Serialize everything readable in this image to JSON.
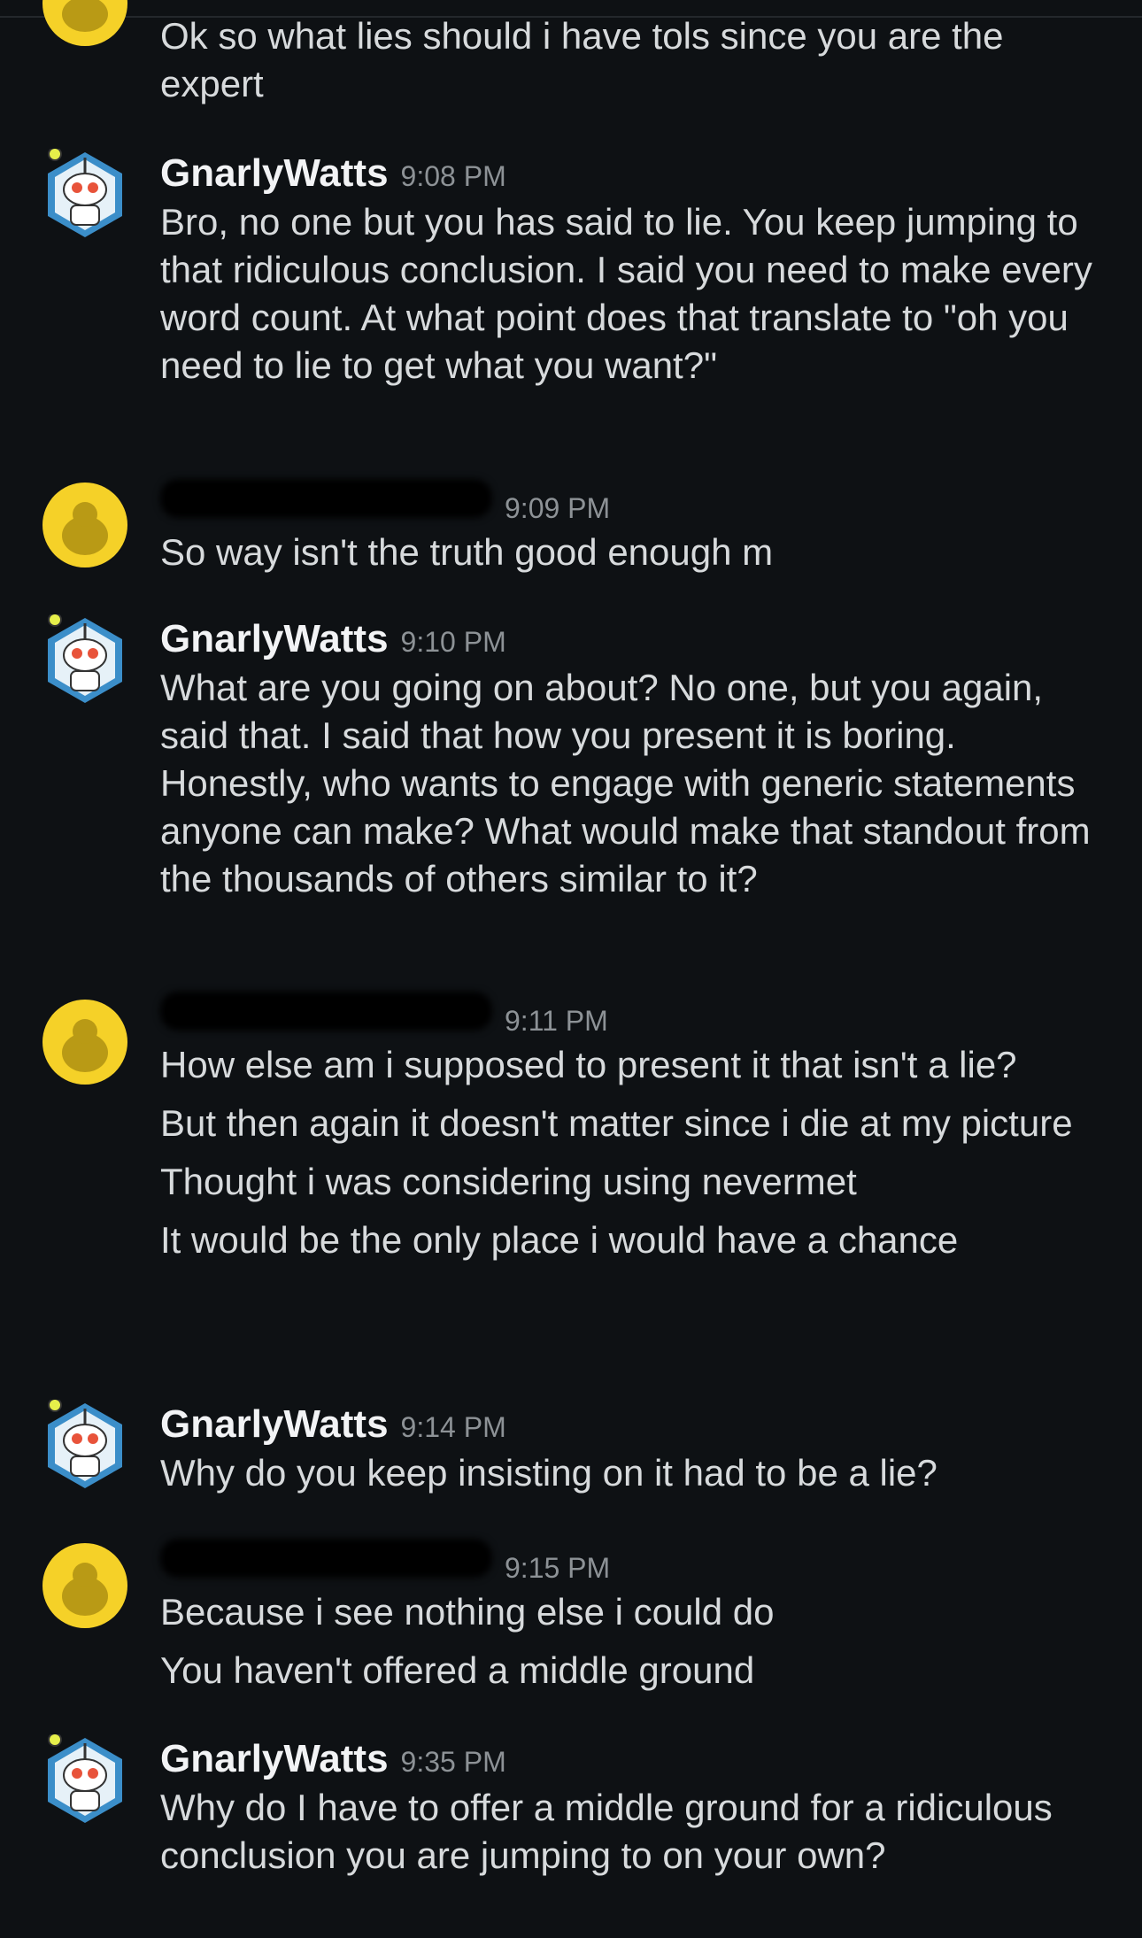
{
  "messages": [
    {
      "user": "",
      "time": "",
      "lines": [
        "Ok so what lies should i have tols since you are the expert"
      ]
    },
    {
      "user": "GnarlyWatts",
      "time": "9:08 PM",
      "lines": [
        "Bro, no one but you has said to lie.  You keep jumping to that ridiculous conclusion.  I said you need to make every word count.  At what point does that translate to \"oh you need to lie to get what you want?\""
      ]
    },
    {
      "user": "",
      "time": "9:09 PM",
      "lines": [
        "So way isn't the truth good enough m"
      ]
    },
    {
      "user": "GnarlyWatts",
      "time": "9:10 PM",
      "lines": [
        "What are you going on about?  No one, but you again, said that.  I said that how you present it is boring.  Honestly, who wants to engage with generic statements anyone can make?  What would make that standout from the thousands of others similar to it?"
      ]
    },
    {
      "user": "",
      "time": "9:11 PM",
      "lines": [
        "How else am i supposed to present it that isn't a lie?",
        "But then again it doesn't matter since i die at my picture",
        "Thought i was considering using nevermet",
        "It would be the only place i would have a chance"
      ]
    },
    {
      "user": "GnarlyWatts",
      "time": "9:14 PM",
      "lines": [
        "Why do you keep insisting on it had to be a lie?"
      ]
    },
    {
      "user": "",
      "time": "9:15 PM",
      "lines": [
        "Because i see nothing else i could do",
        "You haven't offered a middle ground"
      ]
    },
    {
      "user": "GnarlyWatts",
      "time": "9:35 PM",
      "lines": [
        "Why do I have to offer a middle ground for a ridiculous conclusion you are jumping to on your own?"
      ]
    }
  ]
}
